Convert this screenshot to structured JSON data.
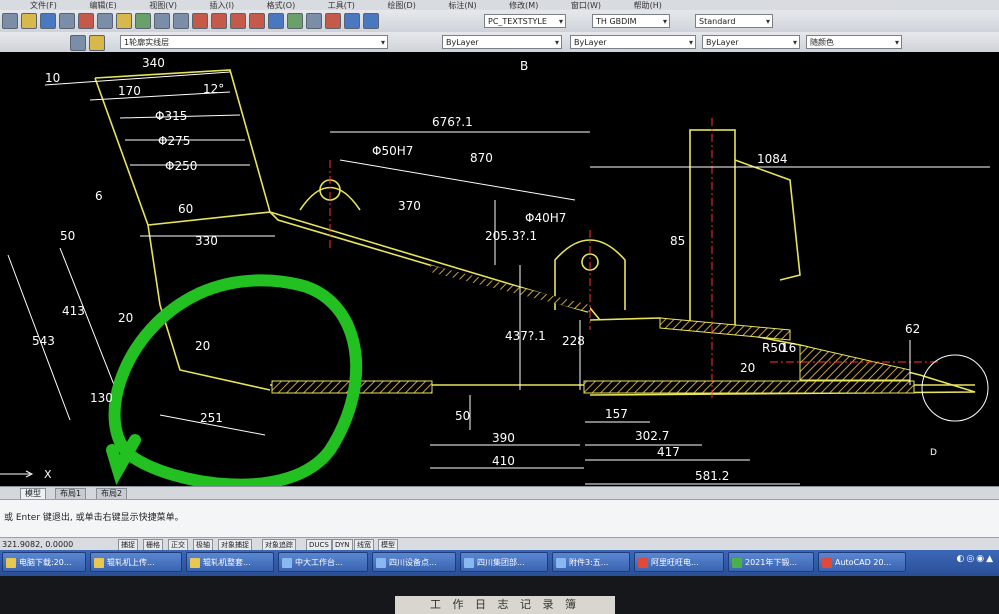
{
  "menubar": {
    "items": [
      "文件(F)",
      "编辑(E)",
      "视图(V)",
      "插入(I)",
      "格式(O)",
      "工具(T)",
      "绘图(D)",
      "标注(N)",
      "修改(M)",
      "窗口(W)",
      "帮助(H)"
    ]
  },
  "toolbar": {
    "text_style": "PC_TEXTSTYLE",
    "dim_style": "TH GBDIM",
    "table_style": "Standard",
    "layer": "1轮廓实线层",
    "color": "ByLayer",
    "linetype": "ByLayer",
    "lineweight": "ByLayer",
    "plot_style": "随颜色"
  },
  "drawing": {
    "view_label": "B",
    "view_label_2": "D",
    "dims": {
      "d10": "10",
      "d340": "340",
      "d170": "170",
      "d12": "12°",
      "d315": "Φ315",
      "d275": "Φ275",
      "d250": "Φ250",
      "d6": "6",
      "d60": "60",
      "d330": "330",
      "d50a": "50",
      "d413": "413",
      "d543": "543",
      "d20a": "20",
      "d130": "130",
      "d20b": "20",
      "d251": "251",
      "d6762": "676?.1",
      "d50h7": "Φ50H7",
      "d870": "870",
      "d370": "370",
      "d2053": "205.3?.1",
      "d40h7": "Φ40H7",
      "d4372": "437?.1",
      "d228": "228",
      "d1084": "1084",
      "d85": "85",
      "d62": "62",
      "d50r": "R50",
      "d16": "16",
      "d20c": "20",
      "d50b": "50",
      "d390": "390",
      "d410": "410",
      "d157": "157",
      "d3027": "302.7",
      "d417": "417",
      "d5812": "581.2"
    }
  },
  "tabs": {
    "model": "模型",
    "layout1": "布局1",
    "layout2": "布局2"
  },
  "command": {
    "prompt": "或 Enter 键退出, 或单击右键显示快捷菜单。"
  },
  "status": {
    "coords": "321.9082, 0.0000",
    "buttons": [
      "捕捉",
      "栅格",
      "正交",
      "极轴",
      "对象捕捉",
      "对象追踪",
      "DUCS",
      "DYN",
      "线宽",
      "模型"
    ]
  },
  "taskbar": {
    "items": [
      "电脑下载:20...",
      "辊轧机上传...",
      "辊轧机整套...",
      "中大工作台...",
      "四川设备点...",
      "四川集团部...",
      "附件3:五...",
      "阿里旺旺电...",
      "2021年下锻...",
      "AutoCAD 20..."
    ]
  },
  "plate": {
    "text": "工 作 日 志 记 录 簿"
  },
  "colors": {
    "canvas": "#000000",
    "dim": "#ffffff",
    "geometry": "#e8e45a",
    "hatch": "#c8a040",
    "center": "#ff3030",
    "annotation": "#22c020"
  }
}
